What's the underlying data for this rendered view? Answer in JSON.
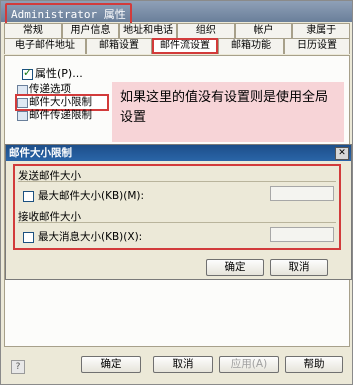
{
  "window": {
    "title": "Administrator 属性"
  },
  "tabs": {
    "row1": [
      "常规",
      "用户信息",
      "地址和电话",
      "组织",
      "帐户",
      "隶属于"
    ],
    "row2": [
      "电子邮件地址",
      "邮箱设置",
      "邮件流设置",
      "邮箱功能",
      "日历设置"
    ]
  },
  "panel": {
    "properties_label": "属性(P)...",
    "tree": [
      "传递选项",
      "邮件大小限制",
      "邮件传递限制"
    ],
    "callout": "如果这里的值没有设置则是使用全局设置"
  },
  "dialog": {
    "title": "邮件大小限制",
    "send_group": "发送邮件大小",
    "send_label": "最大邮件大小(KB)(M):",
    "receive_group": "接收邮件大小",
    "receive_label": "最大消息大小(KB)(X):",
    "ok": "确定",
    "cancel": "取消"
  },
  "footer": {
    "ok": "确定",
    "cancel": "取消",
    "apply": "应用(A)",
    "help": "帮助"
  }
}
